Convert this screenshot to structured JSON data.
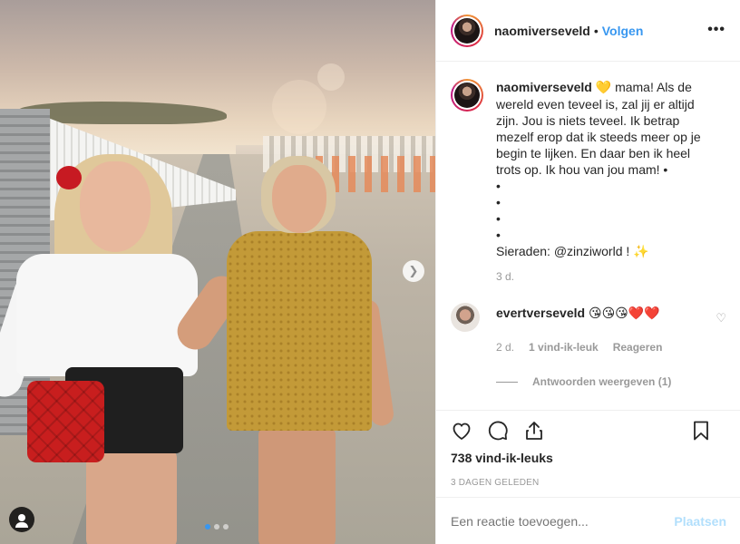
{
  "post": {
    "author": "naomiverseveld",
    "follow_label": "Volgen",
    "separator": "•",
    "more_label": "•••"
  },
  "caption": {
    "username": "naomiverseveld",
    "heart_emoji": "💛",
    "text": "mama! Als de wereld even teveel is, zal jij er altijd zijn. Jou is niets teveel. Ik betrap mezelf erop dat ik steeds meer op je begin te lijken. En daar ben ik heel trots op. Ik hou van jou mam! •",
    "bullets": [
      "•",
      "•",
      "•",
      "•"
    ],
    "jewelry_line": "Sieraden: @zinziworld ! ✨",
    "age": "3 d."
  },
  "comment": {
    "username": "evertverseveld",
    "text": "😘😘😘❤️❤️",
    "age": "2 d.",
    "likes": "1 vind-ik-leuk",
    "reply": "Reageren",
    "view_replies": "Antwoorden weergeven (1)",
    "like_icon": "♡"
  },
  "footer": {
    "likes": "738 vind-ik-leuks",
    "posted": "3 DAGEN GELEDEN",
    "comment_placeholder": "Een reactie toevoegen...",
    "post_label": "Plaatsen"
  },
  "carousel": {
    "next_icon": "❯",
    "current": 1,
    "total": 3
  },
  "colors": {
    "accent": "#3897f0",
    "post_disabled": "#b2dffc",
    "muted": "#999999"
  }
}
